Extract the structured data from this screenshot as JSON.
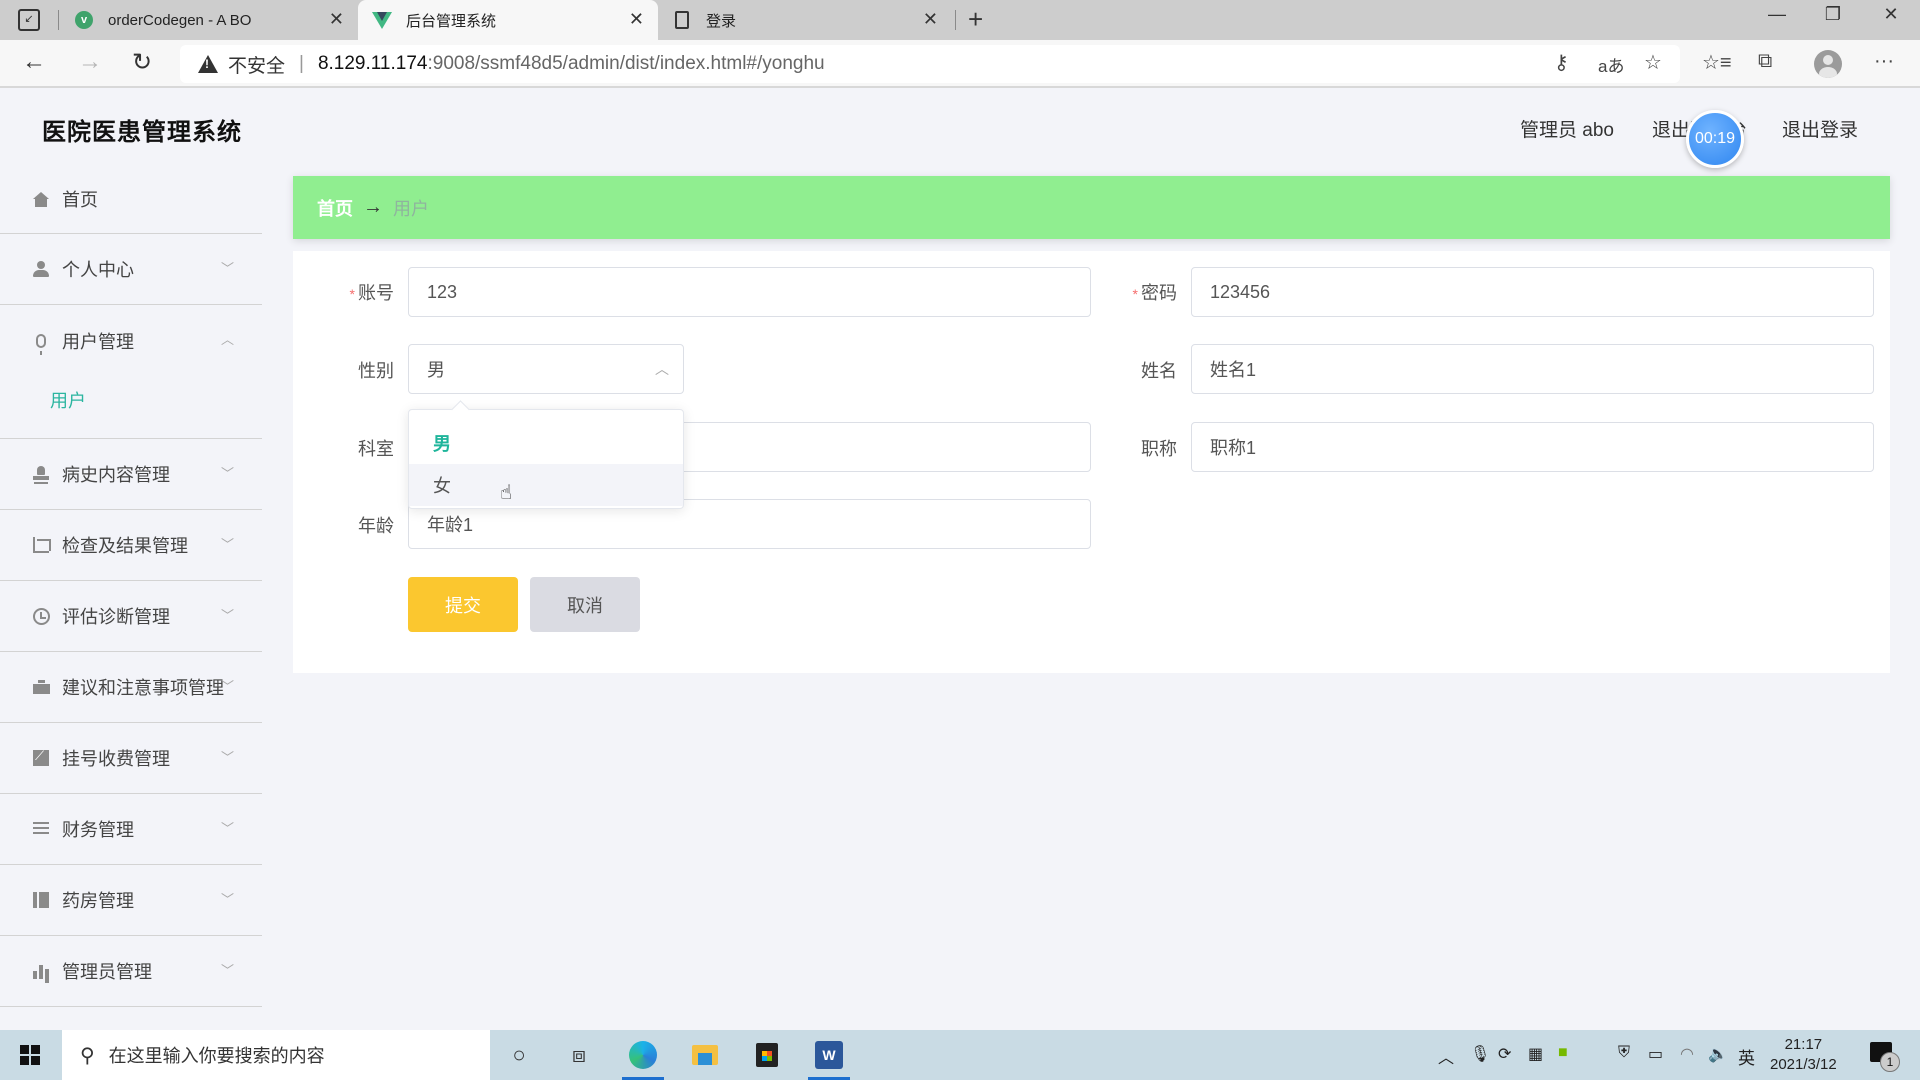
{
  "browser": {
    "tabs": [
      {
        "title": "orderCodegen - A BO",
        "favicon": "vue-circle-icon",
        "active": false
      },
      {
        "title": "后台管理系统",
        "favicon": "vue-logo-icon",
        "active": true
      },
      {
        "title": "登录",
        "favicon": "document-icon",
        "active": false
      }
    ],
    "new_tab_label": "+",
    "security_label": "不安全",
    "url_host": "8.129.11.174",
    "url_path": ":9008/ssmf48d5/admin/dist/index.html#/yonghu",
    "window_controls": {
      "minimize": "—",
      "maximize": "❐",
      "close": "✕"
    }
  },
  "header": {
    "app_title": "医院医患管理系统",
    "user_label": "管理员 abo",
    "frontend_link": "退出到前台",
    "logout_link": "退出登录",
    "timer": "00:19"
  },
  "sidebar": {
    "items": [
      {
        "label": "首页",
        "icon": "home-icon",
        "expandable": false
      },
      {
        "label": "个人中心",
        "icon": "user-icon",
        "expandable": true,
        "expanded": false
      },
      {
        "label": "用户管理",
        "icon": "microphone-icon",
        "expandable": true,
        "expanded": true,
        "children": [
          {
            "label": "用户",
            "active": true
          }
        ]
      },
      {
        "label": "病史内容管理",
        "icon": "stamp-icon",
        "expandable": true,
        "expanded": false
      },
      {
        "label": "检查及结果管理",
        "icon": "crop-icon",
        "expandable": true,
        "expanded": false
      },
      {
        "label": "评估诊断管理",
        "icon": "clock-icon",
        "expandable": true,
        "expanded": false
      },
      {
        "label": "建议和注意事项管理",
        "icon": "briefcase-icon",
        "expandable": true,
        "expanded": false
      },
      {
        "label": "挂号收费管理",
        "icon": "chart-icon",
        "expandable": true,
        "expanded": false
      },
      {
        "label": "财务管理",
        "icon": "list-icon",
        "expandable": true,
        "expanded": false
      },
      {
        "label": "药房管理",
        "icon": "book-icon",
        "expandable": true,
        "expanded": false
      },
      {
        "label": "管理员管理",
        "icon": "bar-chart-icon",
        "expandable": true,
        "expanded": false
      }
    ]
  },
  "breadcrumb": {
    "home": "首页",
    "separator": "→",
    "current": "用户"
  },
  "form": {
    "account": {
      "label": "账号",
      "required": true,
      "value": "123"
    },
    "password": {
      "label": "密码",
      "required": true,
      "value": "123456"
    },
    "gender": {
      "label": "性别",
      "value": "男",
      "options": [
        "男",
        "女"
      ],
      "open": true,
      "hovered_option": "女"
    },
    "name": {
      "label": "姓名",
      "value": "姓名1"
    },
    "department": {
      "label": "科室",
      "value": ""
    },
    "title": {
      "label": "职称",
      "value": "职称1"
    },
    "age": {
      "label": "年龄",
      "value": "年龄1"
    },
    "required_mark": "*",
    "submit_label": "提交",
    "cancel_label": "取消"
  },
  "taskbar": {
    "search_placeholder": "在这里输入你要搜索的内容",
    "ime_label": "英",
    "time": "21:17",
    "date": "2021/3/12",
    "notification_count": "1"
  }
}
